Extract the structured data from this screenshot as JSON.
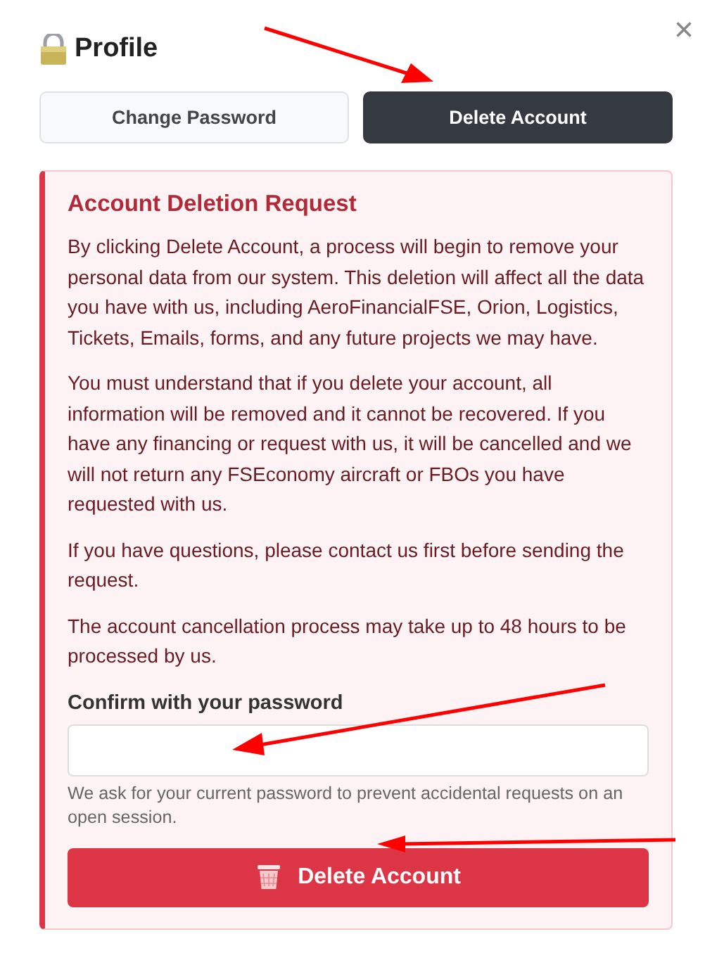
{
  "dialog": {
    "title": "Profile",
    "close": "×"
  },
  "tabs": [
    {
      "label": "Change Password",
      "selected": false
    },
    {
      "label": "Delete Account",
      "selected": true
    }
  ],
  "notice": {
    "heading": "Account Deletion Request",
    "paragraphs": [
      "By clicking Delete Account, a process will begin to remove your personal data from our system. This deletion will affect all the data you have with us, including AeroFinancialFSE, Orion, Logistics, Tickets, Emails, forms, and any future projects we may have.",
      "You must understand that if you delete your account, all information will be removed and it cannot be recovered. If you have any financing or request with us, it will be cancelled and we will not return any FSEconomy aircraft or FBOs you have requested with us.",
      "If you have questions, please contact us first before sending the request.",
      "The account cancellation process may take up to 48 hours to be processed by us."
    ],
    "field_label": "Confirm with your password",
    "field_help": "We ask for your current password to prevent accidental requests on an open session.",
    "submit": "Delete Account"
  }
}
